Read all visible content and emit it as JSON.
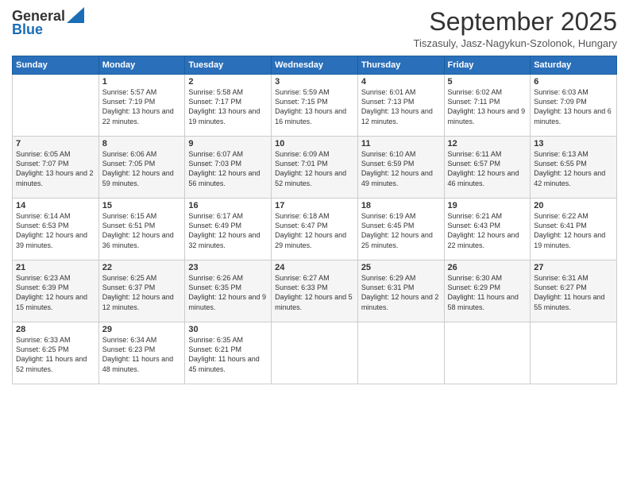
{
  "logo": {
    "line1": "General",
    "line2": "Blue"
  },
  "title": "September 2025",
  "location": "Tiszasuly, Jasz-Nagykun-Szolonok, Hungary",
  "headers": [
    "Sunday",
    "Monday",
    "Tuesday",
    "Wednesday",
    "Thursday",
    "Friday",
    "Saturday"
  ],
  "weeks": [
    [
      {
        "day": "",
        "sunrise": "",
        "sunset": "",
        "daylight": ""
      },
      {
        "day": "1",
        "sunrise": "Sunrise: 5:57 AM",
        "sunset": "Sunset: 7:19 PM",
        "daylight": "Daylight: 13 hours and 22 minutes."
      },
      {
        "day": "2",
        "sunrise": "Sunrise: 5:58 AM",
        "sunset": "Sunset: 7:17 PM",
        "daylight": "Daylight: 13 hours and 19 minutes."
      },
      {
        "day": "3",
        "sunrise": "Sunrise: 5:59 AM",
        "sunset": "Sunset: 7:15 PM",
        "daylight": "Daylight: 13 hours and 16 minutes."
      },
      {
        "day": "4",
        "sunrise": "Sunrise: 6:01 AM",
        "sunset": "Sunset: 7:13 PM",
        "daylight": "Daylight: 13 hours and 12 minutes."
      },
      {
        "day": "5",
        "sunrise": "Sunrise: 6:02 AM",
        "sunset": "Sunset: 7:11 PM",
        "daylight": "Daylight: 13 hours and 9 minutes."
      },
      {
        "day": "6",
        "sunrise": "Sunrise: 6:03 AM",
        "sunset": "Sunset: 7:09 PM",
        "daylight": "Daylight: 13 hours and 6 minutes."
      }
    ],
    [
      {
        "day": "7",
        "sunrise": "Sunrise: 6:05 AM",
        "sunset": "Sunset: 7:07 PM",
        "daylight": "Daylight: 13 hours and 2 minutes."
      },
      {
        "day": "8",
        "sunrise": "Sunrise: 6:06 AM",
        "sunset": "Sunset: 7:05 PM",
        "daylight": "Daylight: 12 hours and 59 minutes."
      },
      {
        "day": "9",
        "sunrise": "Sunrise: 6:07 AM",
        "sunset": "Sunset: 7:03 PM",
        "daylight": "Daylight: 12 hours and 56 minutes."
      },
      {
        "day": "10",
        "sunrise": "Sunrise: 6:09 AM",
        "sunset": "Sunset: 7:01 PM",
        "daylight": "Daylight: 12 hours and 52 minutes."
      },
      {
        "day": "11",
        "sunrise": "Sunrise: 6:10 AM",
        "sunset": "Sunset: 6:59 PM",
        "daylight": "Daylight: 12 hours and 49 minutes."
      },
      {
        "day": "12",
        "sunrise": "Sunrise: 6:11 AM",
        "sunset": "Sunset: 6:57 PM",
        "daylight": "Daylight: 12 hours and 46 minutes."
      },
      {
        "day": "13",
        "sunrise": "Sunrise: 6:13 AM",
        "sunset": "Sunset: 6:55 PM",
        "daylight": "Daylight: 12 hours and 42 minutes."
      }
    ],
    [
      {
        "day": "14",
        "sunrise": "Sunrise: 6:14 AM",
        "sunset": "Sunset: 6:53 PM",
        "daylight": "Daylight: 12 hours and 39 minutes."
      },
      {
        "day": "15",
        "sunrise": "Sunrise: 6:15 AM",
        "sunset": "Sunset: 6:51 PM",
        "daylight": "Daylight: 12 hours and 36 minutes."
      },
      {
        "day": "16",
        "sunrise": "Sunrise: 6:17 AM",
        "sunset": "Sunset: 6:49 PM",
        "daylight": "Daylight: 12 hours and 32 minutes."
      },
      {
        "day": "17",
        "sunrise": "Sunrise: 6:18 AM",
        "sunset": "Sunset: 6:47 PM",
        "daylight": "Daylight: 12 hours and 29 minutes."
      },
      {
        "day": "18",
        "sunrise": "Sunrise: 6:19 AM",
        "sunset": "Sunset: 6:45 PM",
        "daylight": "Daylight: 12 hours and 25 minutes."
      },
      {
        "day": "19",
        "sunrise": "Sunrise: 6:21 AM",
        "sunset": "Sunset: 6:43 PM",
        "daylight": "Daylight: 12 hours and 22 minutes."
      },
      {
        "day": "20",
        "sunrise": "Sunrise: 6:22 AM",
        "sunset": "Sunset: 6:41 PM",
        "daylight": "Daylight: 12 hours and 19 minutes."
      }
    ],
    [
      {
        "day": "21",
        "sunrise": "Sunrise: 6:23 AM",
        "sunset": "Sunset: 6:39 PM",
        "daylight": "Daylight: 12 hours and 15 minutes."
      },
      {
        "day": "22",
        "sunrise": "Sunrise: 6:25 AM",
        "sunset": "Sunset: 6:37 PM",
        "daylight": "Daylight: 12 hours and 12 minutes."
      },
      {
        "day": "23",
        "sunrise": "Sunrise: 6:26 AM",
        "sunset": "Sunset: 6:35 PM",
        "daylight": "Daylight: 12 hours and 9 minutes."
      },
      {
        "day": "24",
        "sunrise": "Sunrise: 6:27 AM",
        "sunset": "Sunset: 6:33 PM",
        "daylight": "Daylight: 12 hours and 5 minutes."
      },
      {
        "day": "25",
        "sunrise": "Sunrise: 6:29 AM",
        "sunset": "Sunset: 6:31 PM",
        "daylight": "Daylight: 12 hours and 2 minutes."
      },
      {
        "day": "26",
        "sunrise": "Sunrise: 6:30 AM",
        "sunset": "Sunset: 6:29 PM",
        "daylight": "Daylight: 11 hours and 58 minutes."
      },
      {
        "day": "27",
        "sunrise": "Sunrise: 6:31 AM",
        "sunset": "Sunset: 6:27 PM",
        "daylight": "Daylight: 11 hours and 55 minutes."
      }
    ],
    [
      {
        "day": "28",
        "sunrise": "Sunrise: 6:33 AM",
        "sunset": "Sunset: 6:25 PM",
        "daylight": "Daylight: 11 hours and 52 minutes."
      },
      {
        "day": "29",
        "sunrise": "Sunrise: 6:34 AM",
        "sunset": "Sunset: 6:23 PM",
        "daylight": "Daylight: 11 hours and 48 minutes."
      },
      {
        "day": "30",
        "sunrise": "Sunrise: 6:35 AM",
        "sunset": "Sunset: 6:21 PM",
        "daylight": "Daylight: 11 hours and 45 minutes."
      },
      {
        "day": "",
        "sunrise": "",
        "sunset": "",
        "daylight": ""
      },
      {
        "day": "",
        "sunrise": "",
        "sunset": "",
        "daylight": ""
      },
      {
        "day": "",
        "sunrise": "",
        "sunset": "",
        "daylight": ""
      },
      {
        "day": "",
        "sunrise": "",
        "sunset": "",
        "daylight": ""
      }
    ]
  ]
}
